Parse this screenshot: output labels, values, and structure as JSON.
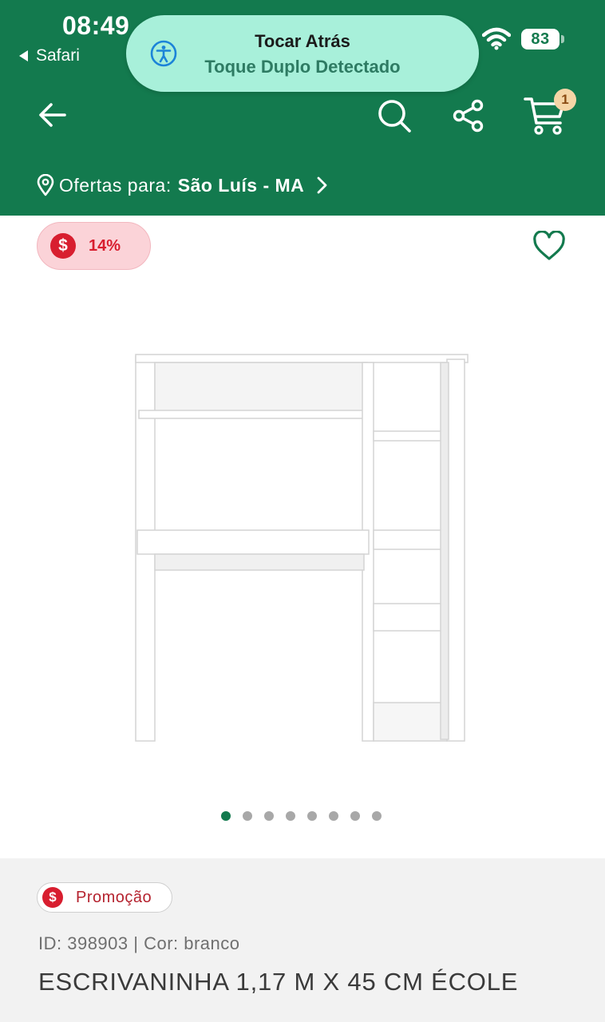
{
  "status_bar": {
    "time": "08:49",
    "back_app": "Safari",
    "battery": "83"
  },
  "toast": {
    "title": "Tocar Atrás",
    "subtitle": "Toque Duplo Detectado",
    "icon": "accessibility-icon"
  },
  "header": {
    "icons": [
      "back-arrow-icon",
      "search-icon",
      "share-icon",
      "cart-icon"
    ],
    "cart_count": "1",
    "location_prefix": "Ofertas para:",
    "location_city": "São Luís - MA"
  },
  "product": {
    "discount": "14%",
    "discount_symbol": "$",
    "image_count": 8,
    "active_image": 1,
    "promo_label": "Promoção",
    "id_line": "ID: 398903 | Cor: branco",
    "title": "ESCRIVANINHA 1,17 M X 45 CM ÉCOLE"
  },
  "colors": {
    "brand_green": "#137a4e",
    "toast_bg": "#a8f0da",
    "discount_red": "#d81e2f",
    "discount_bg": "#fbd3d8"
  }
}
